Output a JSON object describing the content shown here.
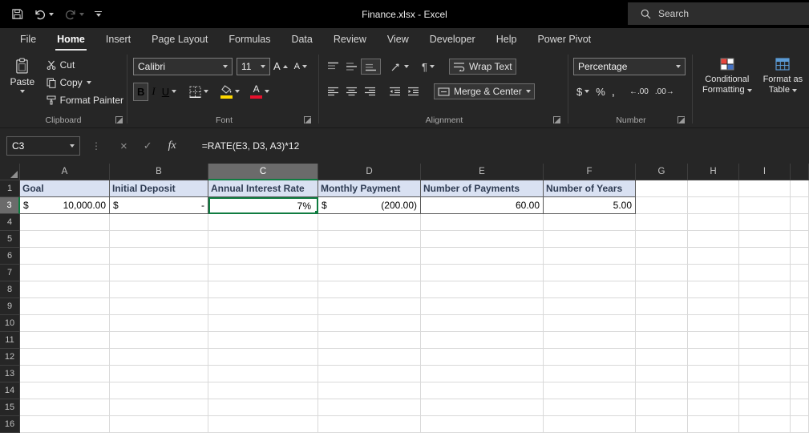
{
  "titlebar": {
    "title": "Finance.xlsx  -  Excel",
    "search_placeholder": "Search"
  },
  "tabs": [
    {
      "label": "File"
    },
    {
      "label": "Home",
      "active": true
    },
    {
      "label": "Insert"
    },
    {
      "label": "Page Layout"
    },
    {
      "label": "Formulas"
    },
    {
      "label": "Data"
    },
    {
      "label": "Review"
    },
    {
      "label": "View"
    },
    {
      "label": "Developer"
    },
    {
      "label": "Help"
    },
    {
      "label": "Power Pivot"
    }
  ],
  "ribbon": {
    "clipboard": {
      "paste": "Paste",
      "cut": "Cut",
      "copy": "Copy",
      "format_painter": "Format Painter",
      "label": "Clipboard"
    },
    "font": {
      "family": "Calibri",
      "size": "11",
      "bold": "B",
      "italic": "I",
      "underline": "U",
      "grow": "A",
      "shrink": "A",
      "label": "Font"
    },
    "alignment": {
      "wrap_text": "Wrap Text",
      "merge_center": "Merge & Center",
      "label": "Alignment"
    },
    "number": {
      "format": "Percentage",
      "currency": "$",
      "percent": "%",
      "comma": ",",
      "increase_decimal": "←.00",
      "decrease_decimal": ".00→",
      "label": "Number"
    },
    "styles": {
      "conditional_1": "Conditional",
      "conditional_2": "Formatting",
      "table_1": "Format as",
      "table_2": "Table"
    }
  },
  "formula_bar": {
    "name_box": "C3",
    "fx": "fx",
    "formula": "=RATE(E3, D3, A3)*12"
  },
  "colors": {
    "selection": "#107C41",
    "header_fill": "#D9E1F2",
    "header_text": "#2E3B52",
    "fill_swatch": "#FFD800",
    "font_swatch": "#E8112D",
    "cf_red": "#E8453C",
    "cf_white": "#FFFFFF",
    "cf_blue": "#4472C4",
    "table_blue": "#5B9BD5"
  },
  "grid": {
    "columns": [
      "A",
      "B",
      "C",
      "D",
      "E",
      "F",
      "G",
      "H",
      "I"
    ],
    "selected": {
      "column": "C",
      "row": "3",
      "cell": "C3"
    },
    "rows": [
      {
        "n": "1",
        "cells": [
          {
            "col": "A",
            "type": "header",
            "text": "Goal"
          },
          {
            "col": "B",
            "type": "header",
            "text": "Initial Deposit"
          },
          {
            "col": "C",
            "type": "header",
            "text": "Annual Interest Rate"
          },
          {
            "col": "D",
            "type": "header",
            "text": "Monthly Payment"
          },
          {
            "col": "E",
            "type": "header",
            "text": "Number of Payments"
          },
          {
            "col": "F",
            "type": "header",
            "text": "Number of Years"
          }
        ]
      },
      {
        "n": "3",
        "cells": [
          {
            "col": "A",
            "type": "data",
            "fmt": "acc",
            "prefix": "$",
            "value": "10,000.00"
          },
          {
            "col": "B",
            "type": "data",
            "fmt": "acc",
            "prefix": "$",
            "value": "-"
          },
          {
            "col": "C",
            "type": "data",
            "fmt": "right",
            "value": "7%",
            "selected": true
          },
          {
            "col": "D",
            "type": "data",
            "fmt": "acc",
            "prefix": "$",
            "value": "(200.00)"
          },
          {
            "col": "E",
            "type": "data",
            "fmt": "right",
            "value": "60.00"
          },
          {
            "col": "F",
            "type": "data",
            "fmt": "right",
            "value": "5.00"
          }
        ]
      },
      {
        "n": "4"
      },
      {
        "n": "5"
      },
      {
        "n": "6"
      },
      {
        "n": "7"
      },
      {
        "n": "8"
      },
      {
        "n": "9"
      },
      {
        "n": "10"
      },
      {
        "n": "11"
      },
      {
        "n": "12"
      },
      {
        "n": "13"
      },
      {
        "n": "14"
      },
      {
        "n": "15"
      },
      {
        "n": "16"
      }
    ]
  }
}
